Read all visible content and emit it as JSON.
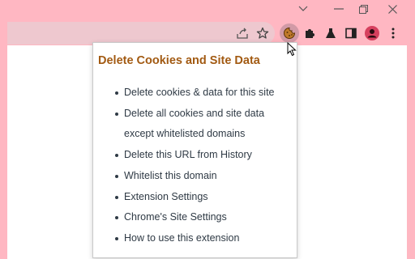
{
  "popup": {
    "title": "Delete Cookies and Site Data",
    "items": [
      "Delete cookies & data for this site",
      "Delete all cookies and site data",
      "except whitelisted domains",
      "Delete this URL from History",
      "Whitelist this domain",
      "Extension Settings",
      "Chrome's Site Settings",
      "How to use this extension"
    ]
  },
  "colors": {
    "chrome_bg": "#ffb7c2",
    "omnibox": "#eec8cf",
    "title_color": "#a25a12",
    "text_color": "#2f3a45"
  },
  "icons": [
    "chevron-down-icon",
    "minimize-icon",
    "restore-icon",
    "close-icon",
    "share-icon",
    "star-icon",
    "cookie-extension-icon",
    "puzzle-icon",
    "flask-icon",
    "sidepanel-icon",
    "profile-avatar-icon",
    "kebab-menu-icon",
    "mouse-cursor-icon"
  ]
}
